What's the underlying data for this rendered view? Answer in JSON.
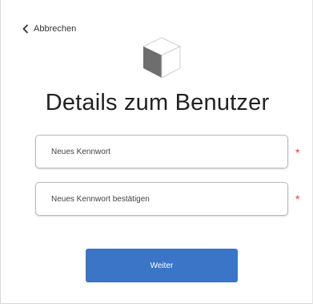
{
  "nav": {
    "back_label": "Abbrechen"
  },
  "header": {
    "title": "Details zum Benutzer",
    "icon": "cube-icon"
  },
  "form": {
    "new_password": {
      "placeholder": "Neues Kennwort",
      "value": "",
      "required_mark": "*"
    },
    "confirm_password": {
      "placeholder": "Neues Kennwort bestätigen",
      "value": "",
      "required_mark": "*"
    },
    "submit_label": "Weiter"
  },
  "colors": {
    "primary_button": "#3a75c8",
    "required_asterisk": "#e03b3b"
  }
}
